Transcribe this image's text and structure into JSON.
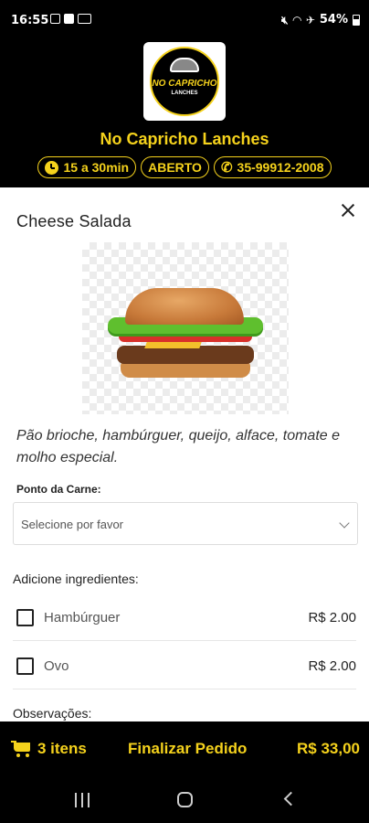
{
  "status_bar": {
    "time": "16:55",
    "battery": "54%"
  },
  "header": {
    "logo_text": "NO CAPRICHO",
    "logo_subtext": "LANCHES",
    "restaurant_name": "No Capricho Lanches",
    "delivery_time": "15 a 30min",
    "open_status": "ABERTO",
    "phone": "35-99912-2008"
  },
  "product": {
    "title": "Cheese Salada",
    "description": "Pão brioche, hambúrguer, queijo, alface, tomate e molho especial.",
    "meat_point": {
      "label": "Ponto da Carne:",
      "placeholder": "Selecione por favor"
    },
    "ingredients_title": "Adicione ingredientes:",
    "ingredients": [
      {
        "name": "Hambúrguer",
        "price": "R$ 2.00"
      },
      {
        "name": "Ovo",
        "price": "R$ 2.00"
      }
    ],
    "observations_label": "Observações:"
  },
  "order_bar": {
    "items": "3 itens",
    "finalize_label": "Finalizar Pedido",
    "total": "R$ 33,00"
  },
  "colors": {
    "accent": "#f5d21c",
    "background": "#000000"
  },
  "icons": [
    "clock-icon",
    "phone-icon",
    "close-icon",
    "chevron-down-icon",
    "cart-icon"
  ]
}
